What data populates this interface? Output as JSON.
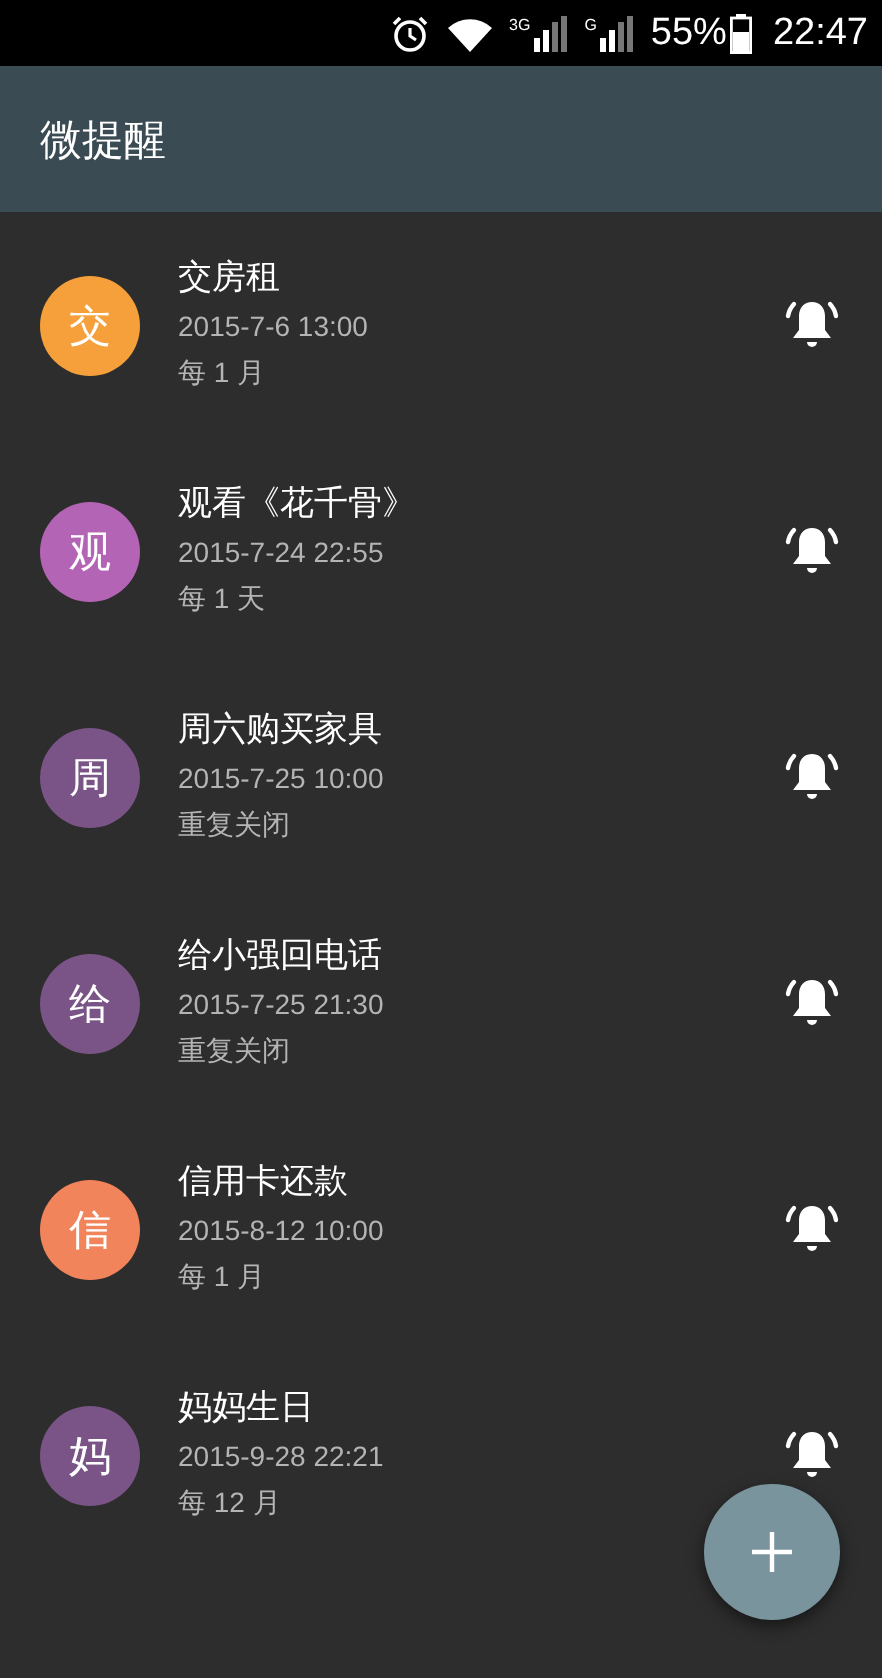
{
  "status_bar": {
    "battery_text": "55%",
    "time": "22:47",
    "network_labels": [
      "3G",
      "G"
    ]
  },
  "app_bar": {
    "title": "微提醒"
  },
  "reminders": [
    {
      "initial": "交",
      "color": "#f5a03a",
      "title": "交房租",
      "datetime": "2015-7-6 13:00",
      "repeat": "每 1 月"
    },
    {
      "initial": "观",
      "color": "#b464b4",
      "title": "观看《花千骨》",
      "datetime": "2015-7-24 22:55",
      "repeat": "每 1 天"
    },
    {
      "initial": "周",
      "color": "#7a5486",
      "title": "周六购买家具",
      "datetime": "2015-7-25 10:00",
      "repeat": "重复关闭"
    },
    {
      "initial": "给",
      "color": "#7a5486",
      "title": "给小强回电话",
      "datetime": "2015-7-25 21:30",
      "repeat": "重复关闭"
    },
    {
      "initial": "信",
      "color": "#f1845a",
      "title": "信用卡还款",
      "datetime": "2015-8-12 10:00",
      "repeat": "每 1 月"
    },
    {
      "initial": "妈",
      "color": "#7a5486",
      "title": "妈妈生日",
      "datetime": "2015-9-28 22:21",
      "repeat": "每 12 月"
    }
  ]
}
